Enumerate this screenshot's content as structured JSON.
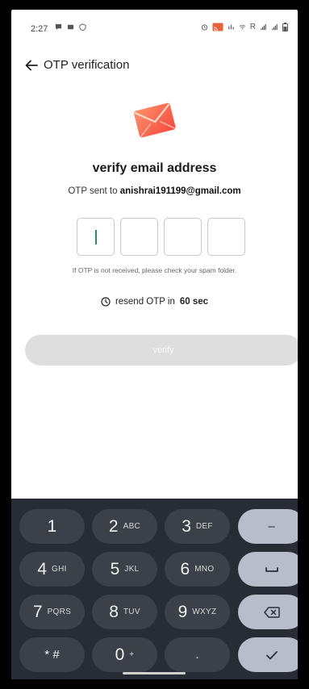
{
  "status_bar": {
    "time": "2:27",
    "network_label": "R"
  },
  "header": {
    "title": "OTP verification"
  },
  "main": {
    "heading": "verify email address",
    "otp_sent_prefix": "OTP sent to",
    "email": "anishrai191199@gmail.com",
    "otp_digits": [
      "",
      "",
      "",
      ""
    ],
    "spam_note": "If OTP is not received, please check your spam folder.",
    "resend_prefix": "resend OTP in",
    "resend_time": "60 sec",
    "verify_label": "verify"
  },
  "keyboard": {
    "keys": [
      {
        "num": "1",
        "sub": ""
      },
      {
        "num": "2",
        "sub": "ABC"
      },
      {
        "num": "3",
        "sub": "DEF"
      },
      {
        "num": "4",
        "sub": "GHI"
      },
      {
        "num": "5",
        "sub": "JKL"
      },
      {
        "num": "6",
        "sub": "MNO"
      },
      {
        "num": "7",
        "sub": "PQRS"
      },
      {
        "num": "8",
        "sub": "TUV"
      },
      {
        "num": "9",
        "sub": "WXYZ"
      },
      {
        "num": "* #",
        "sub": ""
      },
      {
        "num": "0",
        "sub": "+"
      },
      {
        "num": ".",
        "sub": ""
      }
    ],
    "function_keys": {
      "minus": "–",
      "space": "space-icon",
      "backspace": "backspace-icon",
      "done": "check-icon"
    }
  },
  "colors": {
    "accent_cursor": "#2a8a6e",
    "keyboard_bg": "#282c34",
    "key_bg": "#3b4049",
    "fn_key_bg": "#b7bdc9",
    "button_disabled": "#dedede"
  }
}
